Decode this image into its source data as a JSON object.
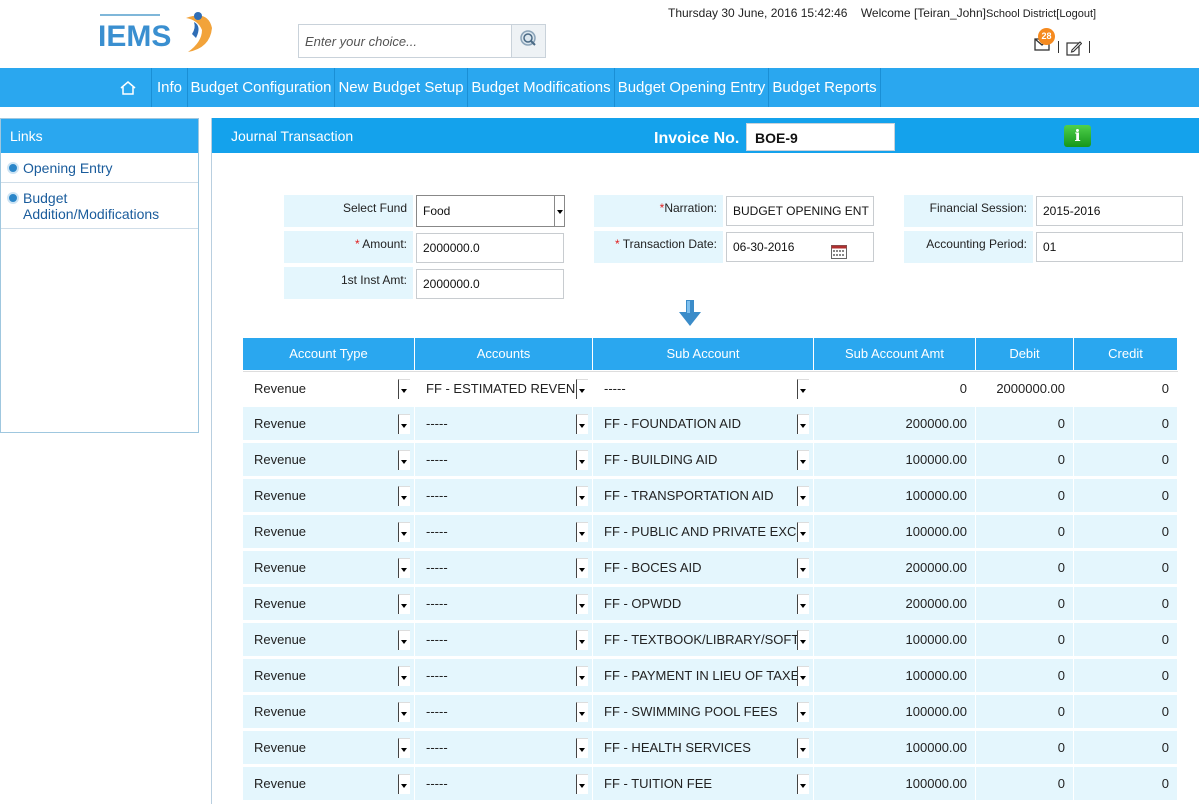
{
  "header": {
    "logo_text": "IEMS",
    "search_placeholder": "Enter your choice...",
    "datetime": "Thursday 30 June, 2016 15:42:46",
    "welcome": "Welcome [Teiran_John]",
    "district": "School District",
    "logout": "[Logout]",
    "mail_badge": "28"
  },
  "nav": {
    "items": [
      "Info",
      "Budget Configuration",
      "New Budget Setup",
      "Budget Modifications",
      "Budget Opening Entry",
      "Budget Reports"
    ]
  },
  "sidebar": {
    "title": "Links",
    "items": [
      "Opening Entry",
      "Budget Addition/Modifications"
    ]
  },
  "panel": {
    "title": "Journal Transaction",
    "invoice_label": "Invoice No.",
    "invoice_value": "BOE-9",
    "info_button": "i"
  },
  "form": {
    "select_fund_label": "Select Fund",
    "select_fund_value": "Food",
    "amount_label": "Amount:",
    "amount_value": "2000000.0",
    "inst_label": "1st Inst Amt:",
    "inst_value": "2000000.0",
    "narration_label": "Narration:",
    "narration_value": "BUDGET OPENING ENT",
    "date_label": "Transaction Date:",
    "date_value": "06-30-2016",
    "session_label": "Financial Session:",
    "session_value": "2015-2016",
    "period_label": "Accounting Period:",
    "period_value": "01"
  },
  "table": {
    "headers": [
      "Account Type",
      "Accounts",
      "Sub Account",
      "Sub Account Amt",
      "Debit",
      "Credit"
    ],
    "rows": [
      [
        "Revenue",
        "FF - ESTIMATED REVENUE",
        "-----",
        "0",
        "2000000.00",
        "0"
      ],
      [
        "Revenue",
        "-----",
        "FF - FOUNDATION AID",
        "200000.00",
        "0",
        "0"
      ],
      [
        "Revenue",
        "-----",
        "FF - BUILDING AID",
        "100000.00",
        "0",
        "0"
      ],
      [
        "Revenue",
        "-----",
        "FF - TRANSPORTATION AID",
        "100000.00",
        "0",
        "0"
      ],
      [
        "Revenue",
        "-----",
        "FF - PUBLIC AND PRIVATE EXCESS",
        "100000.00",
        "0",
        "0"
      ],
      [
        "Revenue",
        "-----",
        "FF - BOCES AID",
        "200000.00",
        "0",
        "0"
      ],
      [
        "Revenue",
        "-----",
        "FF - OPWDD",
        "200000.00",
        "0",
        "0"
      ],
      [
        "Revenue",
        "-----",
        "FF - TEXTBOOK/LIBRARY/SOFTWARE",
        "100000.00",
        "0",
        "0"
      ],
      [
        "Revenue",
        "-----",
        "FF - PAYMENT IN LIEU OF TAXES",
        "100000.00",
        "0",
        "0"
      ],
      [
        "Revenue",
        "-----",
        "FF - SWIMMING POOL FEES",
        "100000.00",
        "0",
        "0"
      ],
      [
        "Revenue",
        "-----",
        "FF - HEALTH SERVICES",
        "100000.00",
        "0",
        "0"
      ],
      [
        "Revenue",
        "-----",
        "FF - TUITION FEE",
        "100000.00",
        "0",
        "0"
      ]
    ]
  },
  "colors": {
    "nav_blue": "#2aa7ef",
    "title_blue": "#14a2ec",
    "row_light": "#e4f6fd",
    "badge_orange": "#f58a1f",
    "info_green": "#22a52a"
  }
}
